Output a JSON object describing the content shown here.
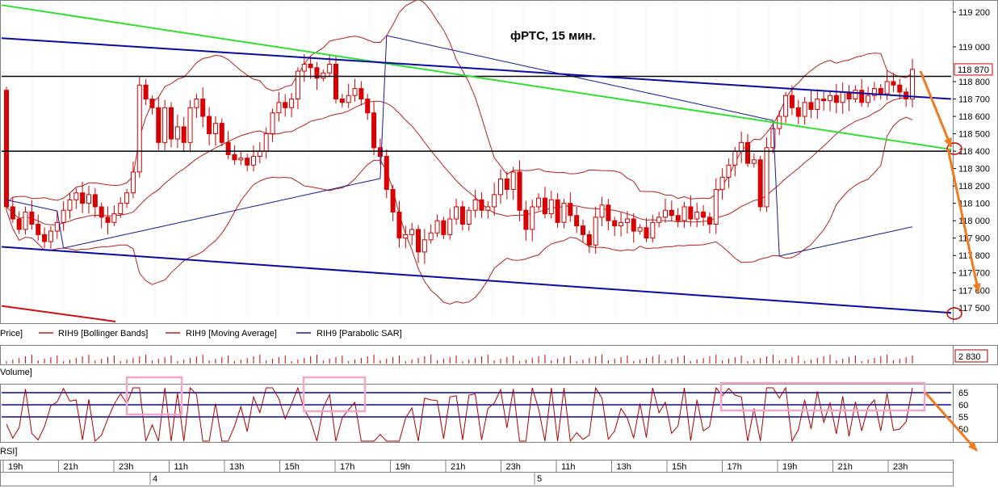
{
  "chart_data": {
    "type": "candlestick",
    "title": "фРТС,  15 мин.",
    "price_axis": {
      "ylim": [
        117420,
        119260
      ],
      "ticks": [
        119200,
        119000,
        118800,
        118700,
        118600,
        118500,
        118400,
        118300,
        118200,
        118100,
        118000,
        117900,
        117800,
        117700,
        117600,
        117500
      ],
      "tick_labels": [
        "119 200",
        "119 000",
        "118 800",
        "118 700",
        "118 600",
        "118 500",
        "118 400",
        "118 300",
        "118 200",
        "118 100",
        "118 000",
        "117 900",
        "117 800",
        "117 700",
        "117 600",
        "117 500"
      ],
      "last_price_label": "118 870",
      "last_price": 118870
    },
    "legend": [
      {
        "label": "Price]",
        "color": "#cc0000"
      },
      {
        "label": "RIH9 [Bollinger Bands]",
        "color": "#b22222"
      },
      {
        "label": "RIH9 [Moving Average]",
        "color": "#b22222"
      },
      {
        "label": "RIH9 [Parabolic SAR]",
        "color": "#1a1a9a"
      }
    ],
    "volume_panel": {
      "label": "Volume]",
      "value_label": "2 830"
    },
    "rsi_panel": {
      "label": "RSI]",
      "ylim": [
        45,
        68
      ],
      "tick_labels": [
        "65",
        "60",
        "55",
        "50"
      ],
      "levels": [
        65,
        60,
        55
      ]
    },
    "time_axis": {
      "tick_labels": [
        "19h",
        "21h",
        "23h",
        "11h",
        "13h",
        "15h",
        "17h",
        "19h",
        "21h",
        "23h",
        "11h",
        "13h",
        "15h",
        "17h",
        "19h",
        "21h",
        "23h"
      ],
      "day_labels": [
        "4",
        "5"
      ]
    },
    "candles_open_close": [
      [
        118750,
        118080
      ],
      [
        118080,
        118010
      ],
      [
        118010,
        117950
      ],
      [
        117950,
        118050
      ],
      [
        118050,
        117980
      ],
      [
        117980,
        117920
      ],
      [
        117920,
        117880
      ],
      [
        117880,
        117940
      ],
      [
        117940,
        117990
      ],
      [
        117990,
        118060
      ],
      [
        118060,
        118120
      ],
      [
        118120,
        118160
      ],
      [
        118160,
        118100
      ],
      [
        118100,
        118150
      ],
      [
        118150,
        118080
      ],
      [
        118080,
        118020
      ],
      [
        118020,
        117990
      ],
      [
        117990,
        118040
      ],
      [
        118040,
        118100
      ],
      [
        118100,
        118160
      ],
      [
        118160,
        118280
      ],
      [
        118280,
        118780
      ],
      [
        118780,
        118700
      ],
      [
        118700,
        118650
      ],
      [
        118650,
        118450
      ],
      [
        118450,
        118650
      ],
      [
        118650,
        118470
      ],
      [
        118470,
        118540
      ],
      [
        118540,
        118450
      ],
      [
        118450,
        118650
      ],
      [
        118650,
        118700
      ],
      [
        118700,
        118600
      ],
      [
        118600,
        118500
      ],
      [
        118500,
        118560
      ],
      [
        118560,
        118450
      ],
      [
        118450,
        118380
      ],
      [
        118380,
        118350
      ],
      [
        118350,
        118360
      ],
      [
        118360,
        118320
      ],
      [
        118320,
        118370
      ],
      [
        118370,
        118400
      ],
      [
        118400,
        118500
      ],
      [
        118500,
        118620
      ],
      [
        118620,
        118680
      ],
      [
        118680,
        118650
      ],
      [
        118650,
        118700
      ],
      [
        118700,
        118860
      ],
      [
        118860,
        118900
      ],
      [
        118900,
        118880
      ],
      [
        118880,
        118820
      ],
      [
        118820,
        118850
      ],
      [
        118850,
        118900
      ],
      [
        118900,
        118700
      ],
      [
        118700,
        118680
      ],
      [
        118680,
        118720
      ],
      [
        118720,
        118760
      ],
      [
        118760,
        118700
      ],
      [
        118700,
        118620
      ],
      [
        118620,
        118420
      ],
      [
        118420,
        118370
      ],
      [
        118370,
        118180
      ],
      [
        118180,
        118050
      ],
      [
        118050,
        117900
      ],
      [
        117900,
        117920
      ],
      [
        117920,
        117950
      ],
      [
        117950,
        117820
      ],
      [
        117820,
        117890
      ],
      [
        117890,
        117930
      ],
      [
        117930,
        118000
      ],
      [
        118000,
        117920
      ],
      [
        117920,
        118010
      ],
      [
        118010,
        118080
      ],
      [
        118080,
        117980
      ],
      [
        117980,
        118060
      ],
      [
        118060,
        118120
      ],
      [
        118120,
        118060
      ],
      [
        118060,
        118080
      ],
      [
        118080,
        118150
      ],
      [
        118150,
        118240
      ],
      [
        118240,
        118180
      ],
      [
        118180,
        118280
      ],
      [
        118280,
        118060
      ],
      [
        118060,
        117950
      ],
      [
        117950,
        118080
      ],
      [
        118080,
        118130
      ],
      [
        118130,
        118040
      ],
      [
        118040,
        118120
      ],
      [
        118120,
        117990
      ],
      [
        117990,
        118100
      ],
      [
        118100,
        118030
      ],
      [
        118030,
        117970
      ],
      [
        117970,
        117920
      ],
      [
        117920,
        117860
      ],
      [
        117860,
        118020
      ],
      [
        118020,
        118090
      ],
      [
        118090,
        118000
      ],
      [
        118000,
        117970
      ],
      [
        117970,
        117990
      ],
      [
        117990,
        118010
      ],
      [
        118010,
        117940
      ],
      [
        117940,
        117960
      ],
      [
        117960,
        117900
      ],
      [
        117900,
        117990
      ],
      [
        117990,
        118020
      ],
      [
        118020,
        118060
      ],
      [
        118060,
        118030
      ],
      [
        118030,
        118000
      ],
      [
        118000,
        118080
      ],
      [
        118080,
        118010
      ],
      [
        118010,
        118050
      ],
      [
        118050,
        118020
      ],
      [
        118020,
        117980
      ],
      [
        117980,
        118180
      ],
      [
        118180,
        118250
      ],
      [
        118250,
        118320
      ],
      [
        118320,
        118400
      ],
      [
        118400,
        118450
      ],
      [
        118450,
        118330
      ],
      [
        118330,
        118350
      ],
      [
        118350,
        118080
      ],
      [
        118080,
        118420
      ],
      [
        118420,
        118530
      ],
      [
        118530,
        118600
      ],
      [
        118600,
        118720
      ],
      [
        118720,
        118650
      ],
      [
        118650,
        118600
      ],
      [
        118600,
        118680
      ],
      [
        118680,
        118640
      ],
      [
        118640,
        118700
      ],
      [
        118700,
        118690
      ],
      [
        118690,
        118720
      ],
      [
        118720,
        118680
      ],
      [
        118680,
        118740
      ],
      [
        118740,
        118700
      ],
      [
        118700,
        118750
      ],
      [
        118750,
        118680
      ],
      [
        118680,
        118720
      ],
      [
        118720,
        118760
      ],
      [
        118760,
        118730
      ],
      [
        118730,
        118800
      ],
      [
        118800,
        118780
      ],
      [
        118780,
        118740
      ],
      [
        118740,
        118700
      ],
      [
        118700,
        118870
      ]
    ],
    "horizontal_lines": [
      118830,
      118400
    ],
    "trend_lines": [
      {
        "color": "#33dd33",
        "from": [
          0,
          119240
        ],
        "to": [
          1,
          118410
        ]
      },
      {
        "color": "#0a0aa0",
        "from": [
          0,
          119050
        ],
        "to": [
          1,
          118700
        ]
      },
      {
        "color": "#0a0aa0",
        "from": [
          0,
          117850
        ],
        "to": [
          1,
          117470
        ]
      },
      {
        "color": "#cc1111",
        "from": [
          0,
          117510
        ],
        "to": [
          0.12,
          117420
        ]
      }
    ]
  }
}
